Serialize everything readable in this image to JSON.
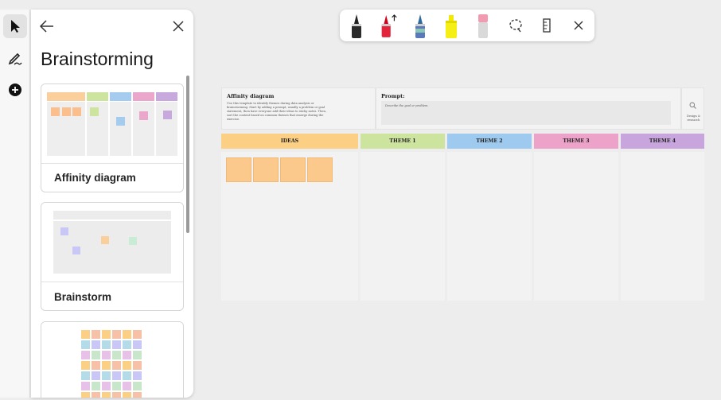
{
  "rail": {
    "items": [
      {
        "icon": "pointer-icon",
        "active": true
      },
      {
        "icon": "pen-draw-icon",
        "active": false
      },
      {
        "icon": "add-circle-icon",
        "active": false
      }
    ]
  },
  "panel": {
    "title": "Brainstorming",
    "templates": [
      {
        "label": "Affinity diagram"
      },
      {
        "label": "Brainstorm"
      },
      {
        "label": ""
      }
    ]
  },
  "toolbar": {
    "tools": [
      "black-pen-icon",
      "red-pen-icon",
      "galaxy-pen-icon",
      "highlighter-icon",
      "eraser-icon",
      "lasso-select-icon",
      "ruler-icon",
      "close-icon"
    ]
  },
  "board": {
    "header_title": "Affinity diagram",
    "header_text": "Use this template to identify themes during data analysis or brainstorming. Start by adding a prompt, usually a problem or goal statement, then have everyone add their ideas to sticky notes. Then, sort the content based on common themes that emerge during the exercise.",
    "prompt_title": "Prompt:",
    "prompt_placeholder": "Describe the goal or problem.",
    "side_label": "Design & research",
    "columns": [
      {
        "label": "IDEAS",
        "color": "#fbcf84"
      },
      {
        "label": "THEME 1",
        "color": "#cde49f"
      },
      {
        "label": "THEME 2",
        "color": "#9fcaef"
      },
      {
        "label": "THEME 3",
        "color": "#eda3c9"
      },
      {
        "label": "THEME 4",
        "color": "#c8a6dd"
      }
    ]
  }
}
